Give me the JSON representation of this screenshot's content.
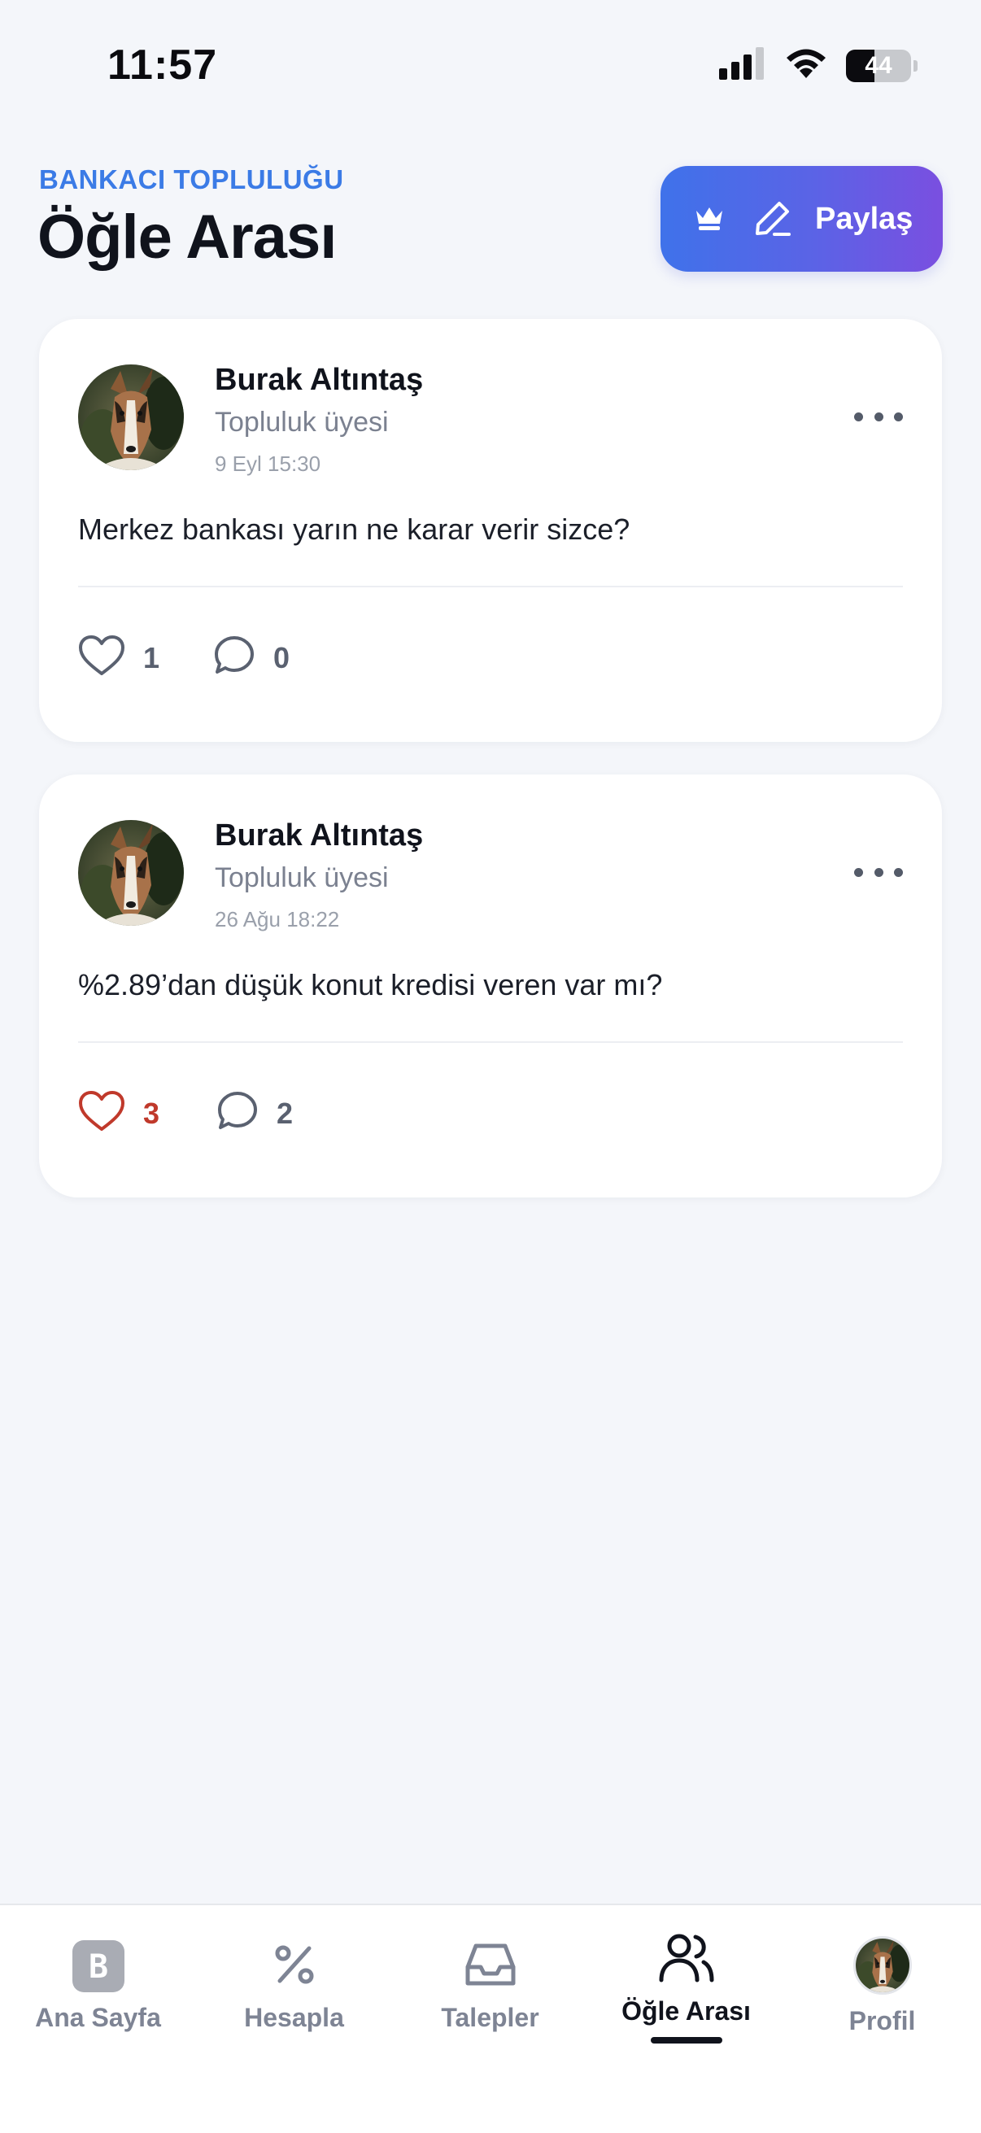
{
  "status_bar": {
    "time": "11:57",
    "battery": "44",
    "battery_level": 0.44
  },
  "header": {
    "community_label": "BANKACI TOPLULUĞU",
    "title": "Öğle Arası",
    "share_label": "Paylaş"
  },
  "posts": [
    {
      "author": "Burak Altıntaş",
      "role": "Topluluk üyesi",
      "time": "9 Eyl 15:30",
      "text": "Merkez bankası yarın ne karar verir sizce?",
      "likes": "1",
      "comments": "0",
      "liked": false
    },
    {
      "author": "Burak Altıntaş",
      "role": "Topluluk üyesi",
      "time": "26 Ağu 18:22",
      "text": "%2.89’dan düşük konut kredisi veren var mı?",
      "likes": "3",
      "comments": "2",
      "liked": true
    }
  ],
  "tabs": [
    {
      "label": "Ana Sayfa",
      "icon": "home-logo-icon",
      "active": false
    },
    {
      "label": "Hesapla",
      "icon": "percent-icon",
      "active": false
    },
    {
      "label": "Talepler",
      "icon": "inbox-icon",
      "active": false
    },
    {
      "label": "Öğle Arası",
      "icon": "users-icon",
      "active": true
    },
    {
      "label": "Profil",
      "icon": "avatar",
      "active": false
    }
  ],
  "colors": {
    "accent": "#3b7be6",
    "share_gradient_start": "#3f72ea",
    "share_gradient_end": "#7a4fe0",
    "liked": "#c0392b",
    "background": "#f4f6fa"
  }
}
